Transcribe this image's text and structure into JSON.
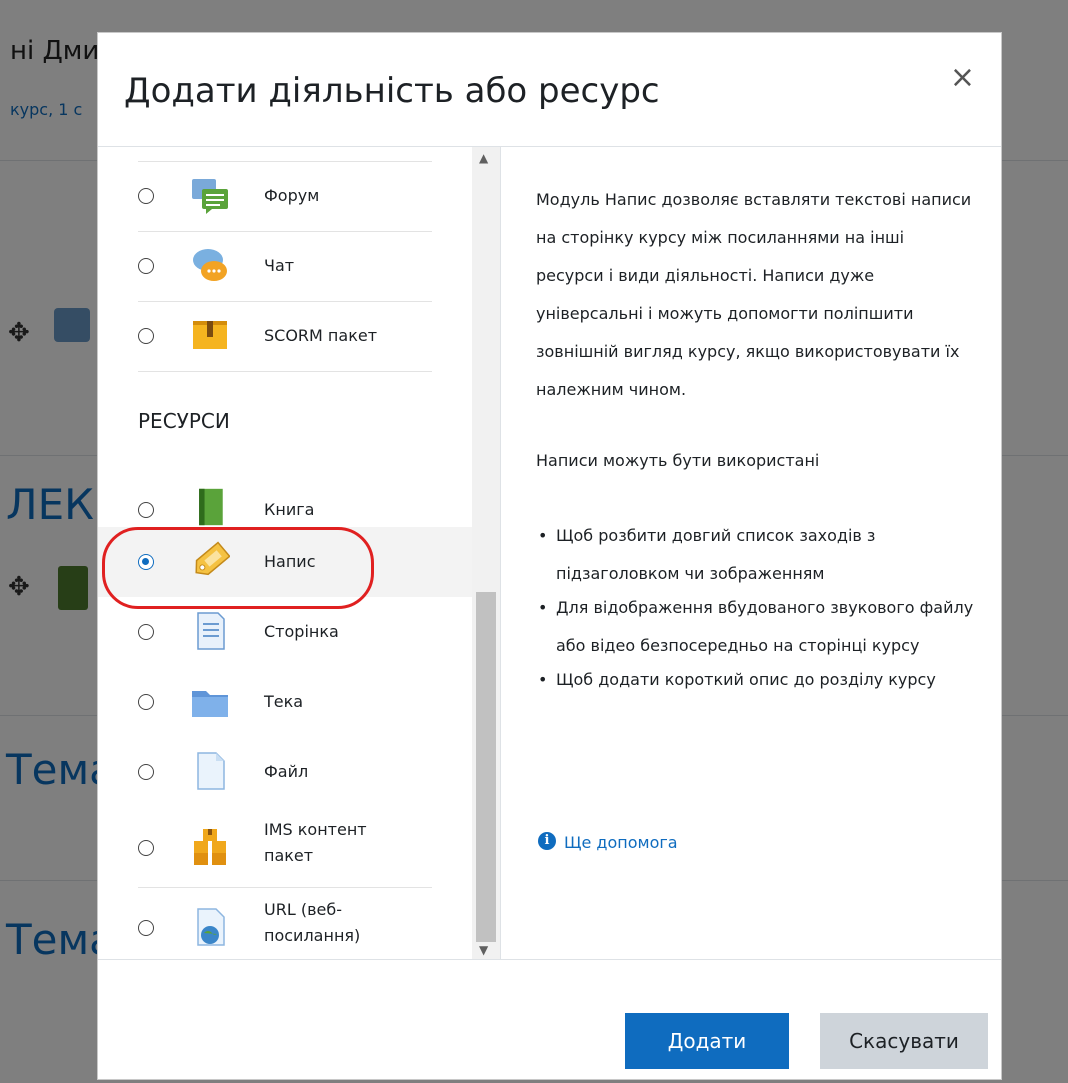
{
  "background": {
    "title_partial": "ні Дми",
    "subtitle_partial": "курс, 1 с",
    "section_partial_1": "ЛЕКЦ",
    "section_partial_2": "Тема",
    "section_partial_3": "Тема"
  },
  "modal": {
    "title": "Додати діяльність або ресурс",
    "close_label": "×",
    "options_top": [
      {
        "label": "Форум",
        "icon": "forum-icon"
      },
      {
        "label": "Чат",
        "icon": "chat-icon"
      },
      {
        "label": "SCORM пакет",
        "icon": "scorm-icon"
      }
    ],
    "section_heading": "РЕСУРСИ",
    "options_resources": [
      {
        "label": "Книга",
        "icon": "book-icon"
      },
      {
        "label": "Напис",
        "icon": "label-tag-icon",
        "selected": true
      },
      {
        "label": "Сторінка",
        "icon": "page-icon"
      },
      {
        "label": "Тека",
        "icon": "folder-icon"
      },
      {
        "label": "Файл",
        "icon": "file-icon"
      },
      {
        "label": "IMS контент пакет",
        "label_line1": "IMS контент",
        "label_line2": "пакет",
        "icon": "ims-package-icon"
      },
      {
        "label": "URL (веб-посилання)",
        "label_line1": "URL (веб-",
        "label_line2": "посилання)",
        "icon": "url-icon"
      }
    ],
    "description": {
      "paragraph1": "Модуль Напис дозволяє вставляти текстові написи на сторінку курсу між посиланнями на інші ресурси і види діяльності. Написи дуже універсальні і можуть допомогти поліпшити зовнішній вигляд курсу, якщо використовувати їх належним чином.",
      "paragraph2": "Написи можуть бути використані",
      "bullets": [
        "Щоб розбити довгий список заходів з підзаголовком чи зображенням",
        "Для відображення вбудованого звукового файлу або відео безпосередньо на сторінці курсу",
        "Щоб додати короткий опис до розділу курсу"
      ],
      "help_link": "Ще допомога"
    },
    "footer": {
      "add_label": "Додати",
      "cancel_label": "Скасувати"
    }
  },
  "colors": {
    "primary": "#0f6cbf",
    "highlight": "#e02020"
  }
}
